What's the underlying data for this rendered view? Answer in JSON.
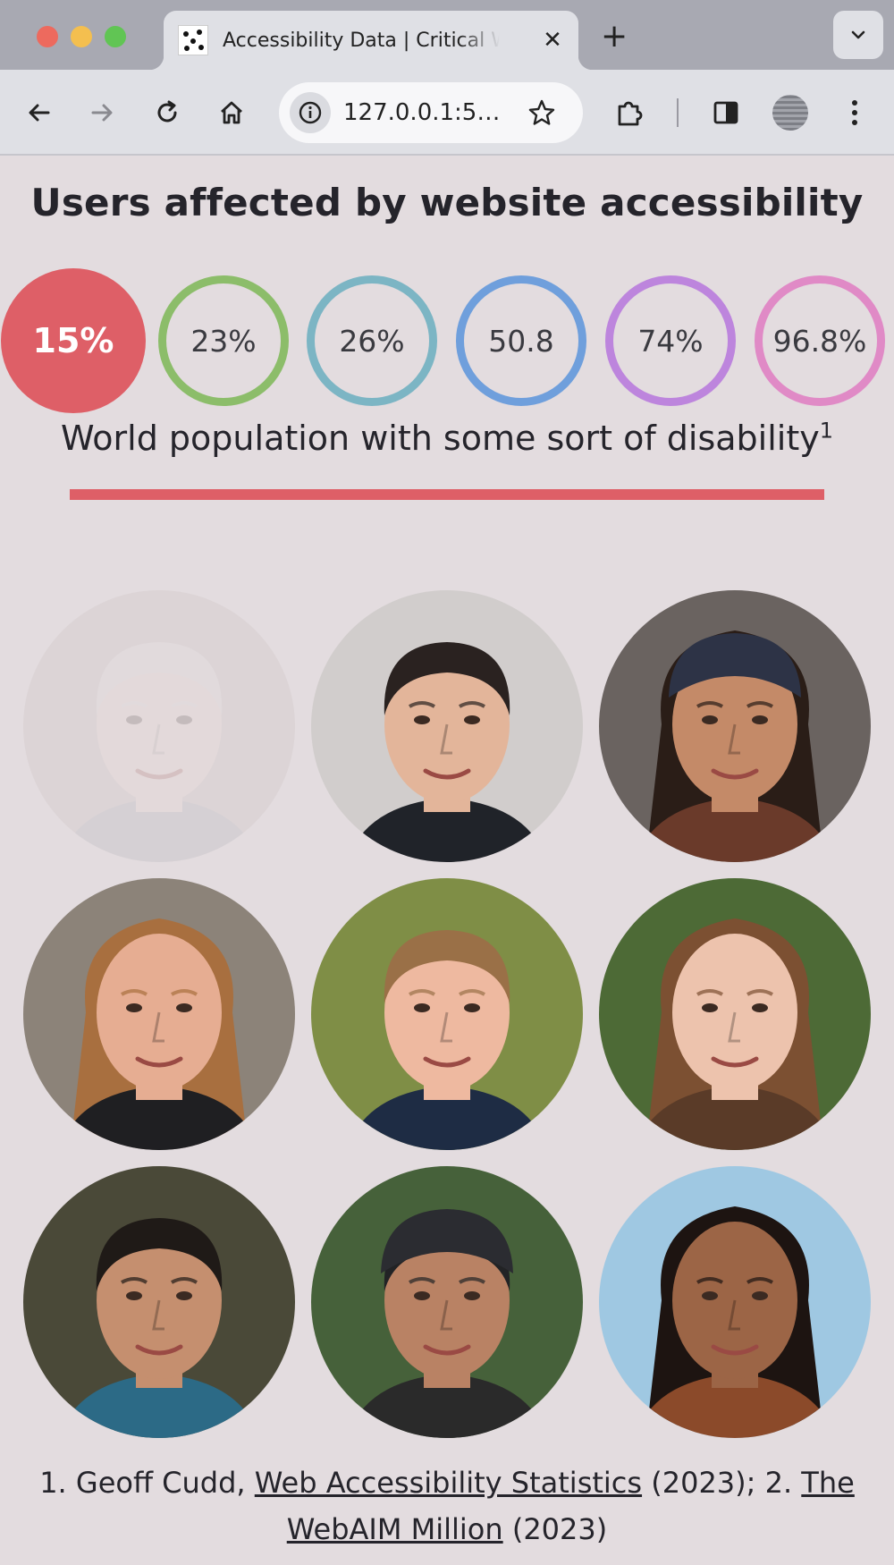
{
  "browser": {
    "tab_title": "Accessibility Data | Critical Web",
    "url": "127.0.0.1:55...",
    "tab_close": "✕",
    "new_tab": "+"
  },
  "page": {
    "title": "Users affected by website accessibility",
    "subtitle": "World population with some sort of disability",
    "subtitle_sup": "1",
    "accent_color": "#de5f67",
    "stats": [
      {
        "label": "15%",
        "color": "#de5f67",
        "style": "filled"
      },
      {
        "label": "23%",
        "color": "#8cbd6a",
        "style": "ring"
      },
      {
        "label": "26%",
        "color": "#7cb5c4",
        "style": "ring"
      },
      {
        "label": "50.8",
        "color": "#6f9fdc",
        "style": "ring"
      },
      {
        "label": "74%",
        "color": "#bd85dd",
        "style": "ring"
      },
      {
        "label": "96.8%",
        "color": "#e08ac6",
        "style": "ring"
      }
    ],
    "faces": [
      {
        "name": "person-1",
        "faded": true
      },
      {
        "name": "person-2",
        "faded": false
      },
      {
        "name": "person-3",
        "faded": false
      },
      {
        "name": "person-4",
        "faded": false
      },
      {
        "name": "person-5",
        "faded": false
      },
      {
        "name": "person-6",
        "faded": false
      },
      {
        "name": "person-7",
        "faded": false
      },
      {
        "name": "person-8",
        "faded": false
      },
      {
        "name": "person-9",
        "faded": false
      }
    ],
    "footnote": {
      "part1": "1. Geoff Cudd, ",
      "link1": "Web Accessibility Statistics",
      "part2": " (2023); 2. ",
      "link2": "The WebAIM Million",
      "part3": " (2023)"
    }
  }
}
